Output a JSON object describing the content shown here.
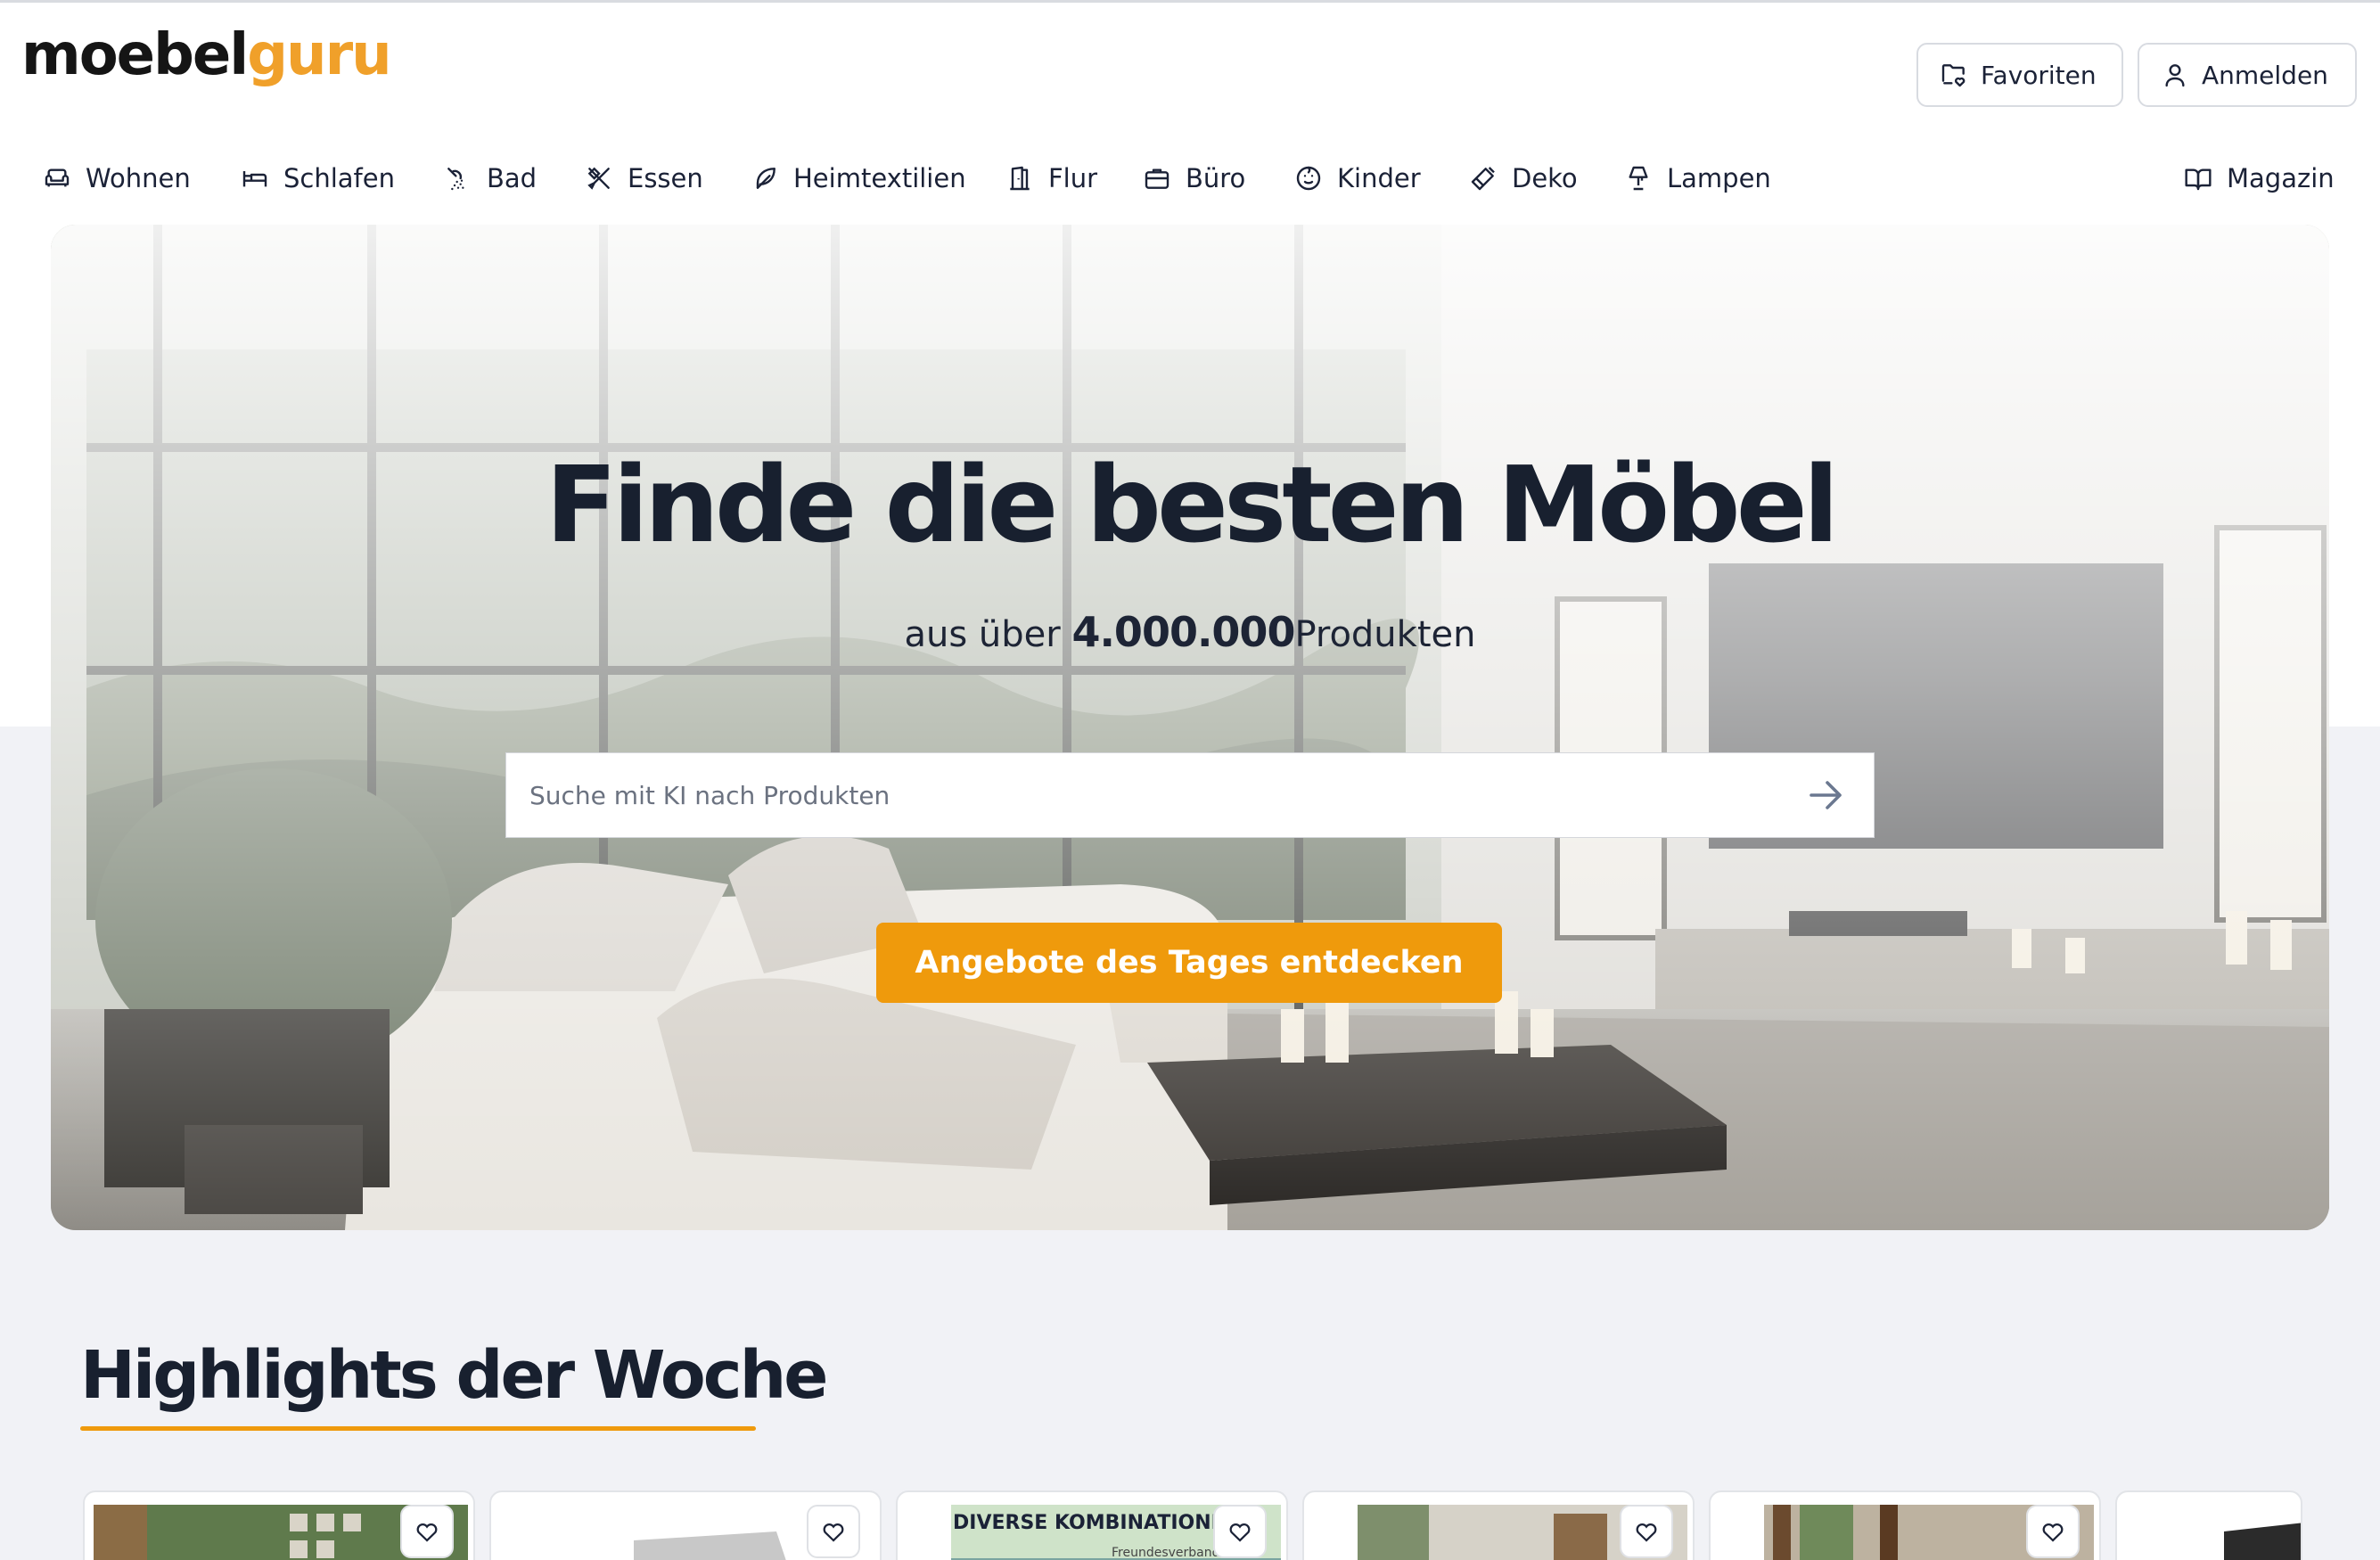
{
  "header": {
    "logo_part1": "moebel",
    "logo_part2": "guru",
    "favorites_label": "Favoriten",
    "login_label": "Anmelden"
  },
  "nav": {
    "items": [
      {
        "label": "Wohnen",
        "icon": "sofa-icon"
      },
      {
        "label": "Schlafen",
        "icon": "bed-icon"
      },
      {
        "label": "Bad",
        "icon": "shower-icon"
      },
      {
        "label": "Essen",
        "icon": "utensils-icon"
      },
      {
        "label": "Heimtextilien",
        "icon": "feather-icon"
      },
      {
        "label": "Flur",
        "icon": "door-icon"
      },
      {
        "label": "Büro",
        "icon": "briefcase-icon"
      },
      {
        "label": "Kinder",
        "icon": "baby-icon"
      },
      {
        "label": "Deko",
        "icon": "paintbrush-icon"
      },
      {
        "label": "Lampen",
        "icon": "lamp-icon"
      }
    ],
    "magazine_label": "Magazin"
  },
  "hero": {
    "title": "Finde die besten Möbel",
    "sub_prefix": "aus über",
    "sub_number": "4.000.000",
    "sub_suffix": "Produkten",
    "search_placeholder": "Suche mit KI nach Produkten",
    "cta_label": "Angebote des Tages entdecken"
  },
  "highlights": {
    "title": "Highlights der Woche",
    "cards": [
      {
        "label": ""
      },
      {
        "label": ""
      },
      {
        "label": "DIVERSE KOMBINATIONEN",
        "sublabel": "Freundesverband"
      },
      {
        "label": ""
      },
      {
        "label": ""
      }
    ]
  },
  "colors": {
    "accent": "#ef9a0c",
    "logo_accent": "#f0a02a",
    "text_dark": "#18202f",
    "page_bg": "#f1f2f6"
  }
}
